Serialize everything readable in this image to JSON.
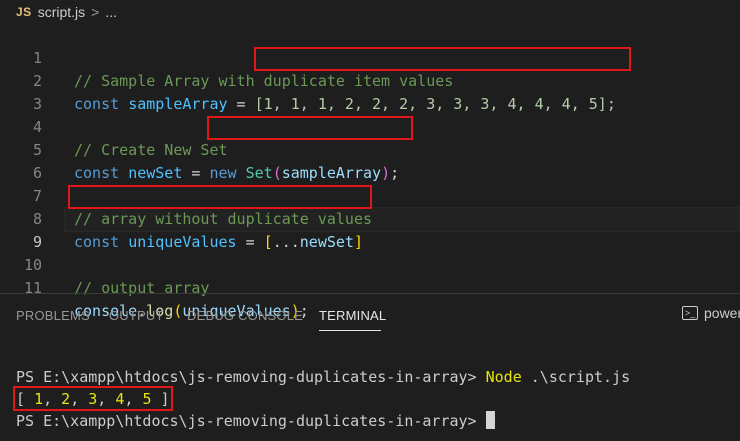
{
  "breadcrumb": {
    "badge": "JS",
    "file": "script.js",
    "separator": ">",
    "more": "..."
  },
  "editor": {
    "lines": [
      {
        "num": "1",
        "comment": "// Sample Array with duplicate item values"
      },
      {
        "num": "2",
        "kw": "const",
        "name": "sampleArray",
        "eq": " = ",
        "value": "[1, 1, 1, 2, 2, 2, 3, 3, 3, 4, 4, 4, 5];"
      },
      {
        "num": "3"
      },
      {
        "num": "4",
        "comment": "// Create New Set"
      },
      {
        "num": "5",
        "kw": "const",
        "name": "newSet",
        "eq": " = ",
        "new": "new",
        "cls": "Set",
        "arg": "sampleArray",
        "end": ");"
      },
      {
        "num": "6"
      },
      {
        "num": "7",
        "comment": "// array without duplicate values"
      },
      {
        "num": "8",
        "kw": "const",
        "name": "uniqueValues",
        "eq": " = ",
        "spread": "...",
        "arg": "newSet"
      },
      {
        "num": "9"
      },
      {
        "num": "10",
        "comment": "// output array"
      },
      {
        "num": "11",
        "obj": "console",
        "fn": "log",
        "arg": "uniqueValues",
        "end": ";"
      }
    ],
    "active_line": "9"
  },
  "panel": {
    "tabs": [
      "PROBLEMS",
      "OUTPUT",
      "DEBUG CONSOLE",
      "TERMINAL"
    ],
    "active_tab": "TERMINAL",
    "shell_label": "powershell",
    "shell_icon": "terminal-icon"
  },
  "terminal": {
    "prompt1": "PS E:\\xampp\\htdocs\\js-removing-duplicates-in-array> ",
    "command_name": "Node",
    "command_arg": " .\\script.js",
    "output_open": "[ ",
    "output_values": [
      "1",
      "2",
      "3",
      "4",
      "5"
    ],
    "output_close": " ]",
    "prompt2": "PS E:\\xampp\\htdocs\\js-removing-duplicates-in-array> "
  },
  "colors": {
    "highlight_box": "#e0161b",
    "background": "#1e1e1e"
  }
}
